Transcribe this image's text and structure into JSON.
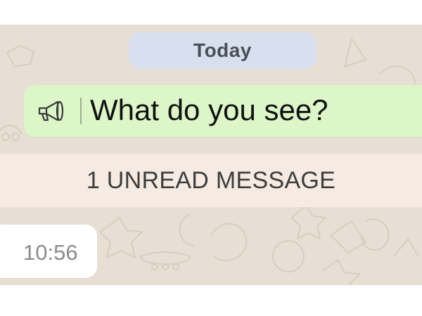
{
  "date_chip": {
    "label": "Today"
  },
  "message": {
    "text": "What do you see?",
    "icon": "megaphone-icon"
  },
  "unread_banner": {
    "label": "1 UNREAD MESSAGE"
  },
  "incoming_bubble": {
    "time": "10:56"
  },
  "colors": {
    "wallpaper": "#e7dfd4",
    "outgoing_bubble": "#dcf6c8",
    "date_chip": "#d8e0f0",
    "unread_banner": "#f5ebe2",
    "incoming_bubble": "#ffffff"
  }
}
